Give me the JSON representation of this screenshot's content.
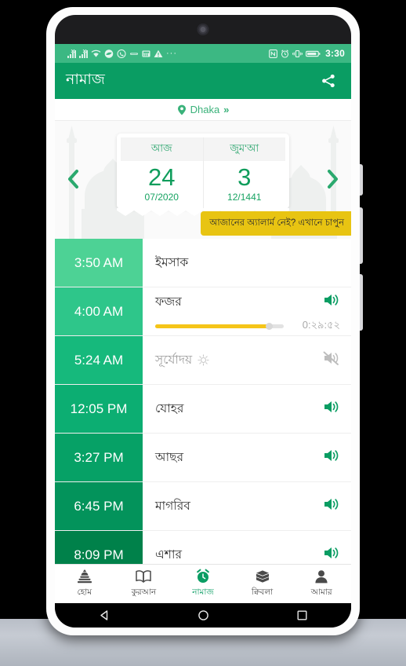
{
  "status_bar": {
    "clock": "3:30",
    "left_icons": [
      "signal-1-icon",
      "signal-2-icon",
      "wifi-icon",
      "cloud-icon",
      "whatsapp-icon",
      "vpn-icon",
      "calculator-icon",
      "warning-icon"
    ],
    "overflow": "···",
    "right_icons": [
      "nfc-icon",
      "alarm-icon",
      "vibrate-icon",
      "battery-icon"
    ]
  },
  "app_bar": {
    "title": "নামাজ",
    "share_icon": "share-icon",
    "bg_color": "#0a9d63"
  },
  "location": {
    "pin_icon": "location-pin-icon",
    "name": "Dhaka",
    "chevrons": "»"
  },
  "date_card": {
    "today": {
      "head": "আজ",
      "number": "24",
      "sub": "07/2020"
    },
    "jumuah": {
      "head": "জুম‘আ",
      "number": "3",
      "sub": "12/1441"
    },
    "prev_arrow_icon": "chevron-left-icon",
    "next_arrow_icon": "chevron-right-icon"
  },
  "alarm_banner": {
    "text": "আজানের অ্যালার্ম নেই? এখানে চাপুন",
    "bg_color": "#e8c412"
  },
  "prayers": [
    {
      "time": "3:50 AM",
      "name": "ইমসাক",
      "bg": "#4dd295",
      "sound": "none",
      "active": false,
      "muted_name": false
    },
    {
      "time": "4:00 AM",
      "name": "ফজর",
      "bg": "#2ec68a",
      "sound": "on",
      "active": true,
      "muted_name": false,
      "progress_percent": 88,
      "countdown": "0:২৯:৫২"
    },
    {
      "time": "5:24 AM",
      "name": "সূর্যোদয়",
      "bg": "#16b97c",
      "sound": "off",
      "active": false,
      "muted_name": true,
      "extra_icon": "sun-icon"
    },
    {
      "time": "12:05 PM",
      "name": "যোহর",
      "bg": "#0cae72",
      "sound": "on",
      "active": false,
      "muted_name": false
    },
    {
      "time": "3:27 PM",
      "name": "আছর",
      "bg": "#06a166",
      "sound": "on",
      "active": false,
      "muted_name": false
    },
    {
      "time": "6:45 PM",
      "name": "মাগরিব",
      "bg": "#03935b",
      "sound": "on",
      "active": false,
      "muted_name": false
    },
    {
      "time": "8:09 PM",
      "name": "এশার",
      "bg": "#00814a",
      "sound": "on",
      "active": false,
      "muted_name": false
    }
  ],
  "bottom_nav": [
    {
      "label": "হোম",
      "icon": "mosque-icon",
      "active": false
    },
    {
      "label": "কুরআন",
      "icon": "quran-book-icon",
      "active": false
    },
    {
      "label": "নামাজ",
      "icon": "alarm-clock-icon",
      "active": true
    },
    {
      "label": "ক্বিবলা",
      "icon": "kaaba-icon",
      "active": false
    },
    {
      "label": "আমার",
      "icon": "person-icon",
      "active": false
    }
  ],
  "android_nav": {
    "back_icon": "triangle-back-icon",
    "home_icon": "circle-home-icon",
    "recents_icon": "square-recents-icon"
  },
  "theme": {
    "primary": "#0a9d63",
    "status_bar": "#3cb883",
    "accent_yellow": "#f5c518"
  }
}
